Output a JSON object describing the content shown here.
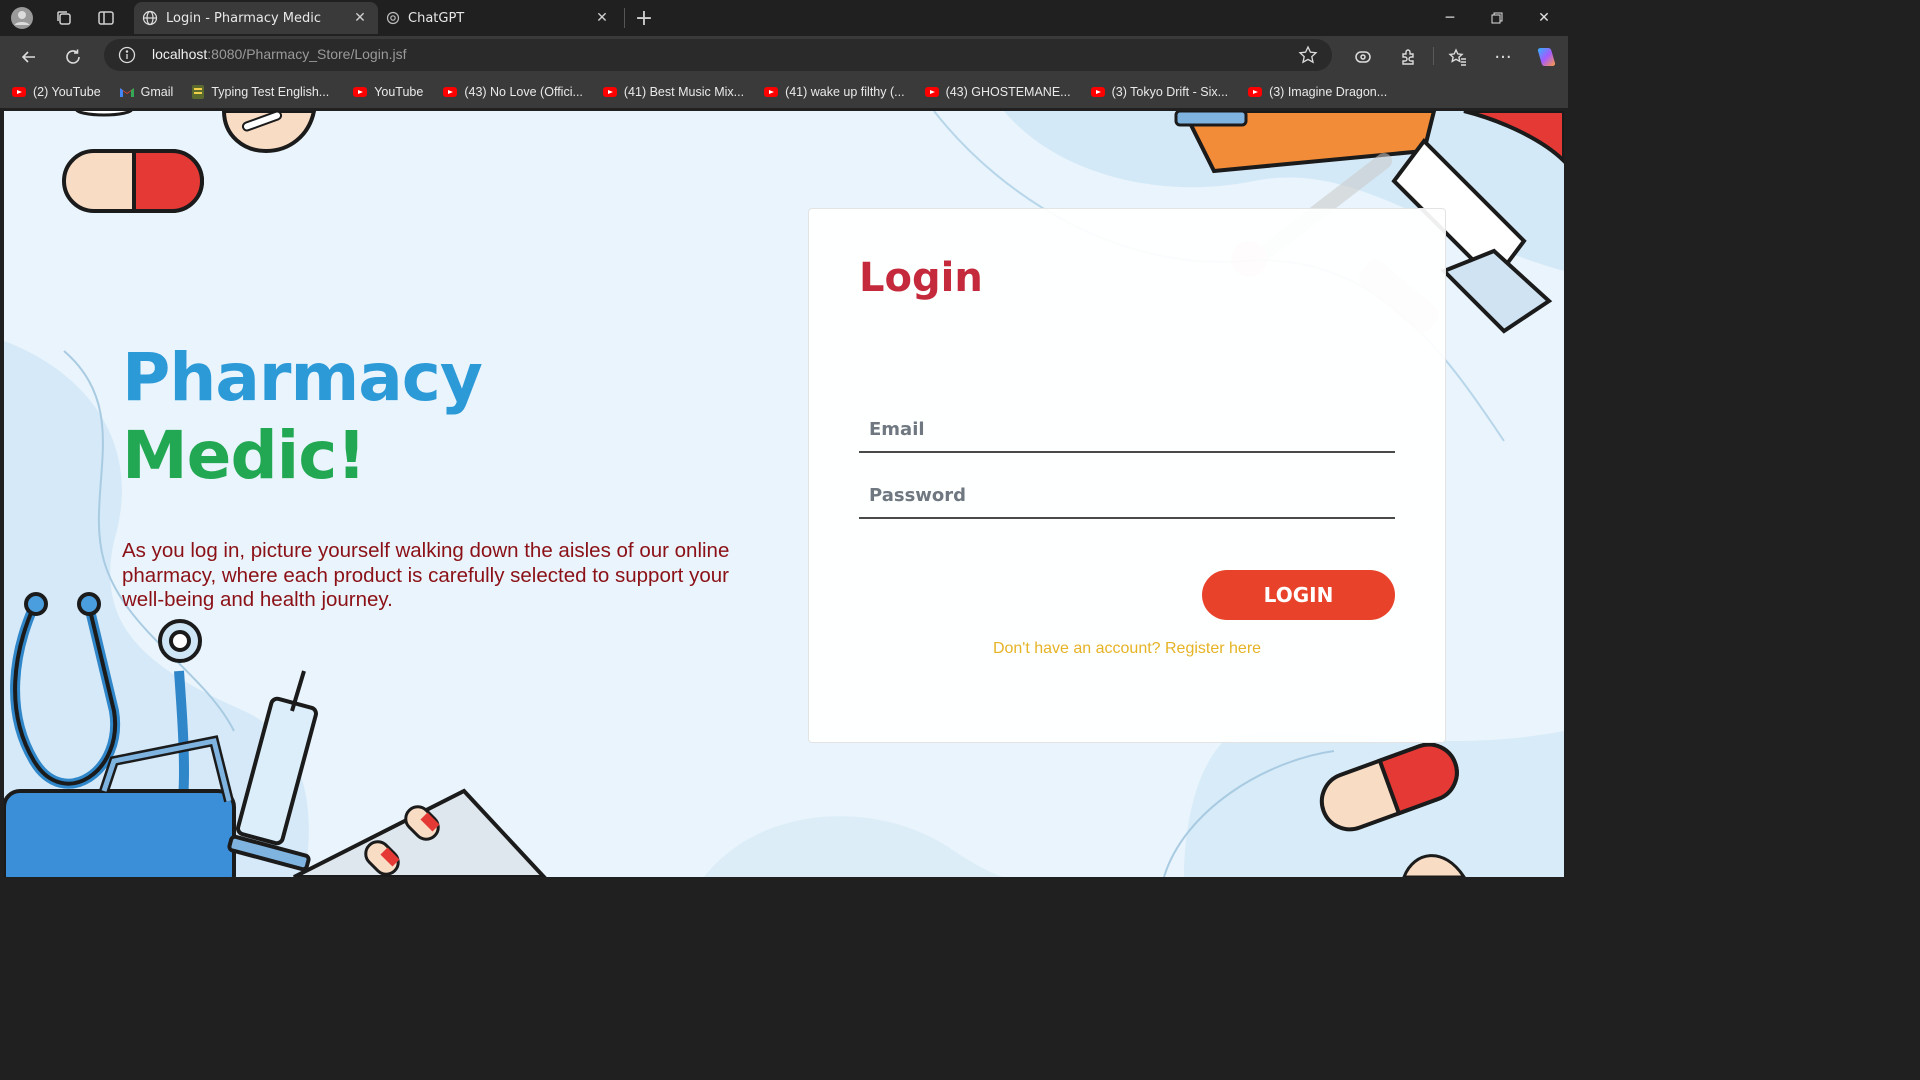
{
  "browser": {
    "tabs": [
      {
        "title": "Login - Pharmacy Medic",
        "icon": "globe-icon",
        "active": true
      },
      {
        "title": "ChatGPT",
        "icon": "chatgpt-icon",
        "active": false
      }
    ],
    "address": {
      "host": "localhost",
      "path": ":8080/Pharmacy_Store/Login.jsf"
    },
    "bookmarks": [
      {
        "label": "(2) YouTube",
        "icon": "youtube-icon"
      },
      {
        "label": "Gmail",
        "icon": "gmail-icon"
      },
      {
        "label": "Typing Test English...",
        "icon": "typing-test-icon"
      },
      {
        "label": "YouTube",
        "icon": "youtube-icon"
      },
      {
        "label": "(43) No Love (Offici...",
        "icon": "youtube-icon"
      },
      {
        "label": "(41) Best Music Mix...",
        "icon": "youtube-icon"
      },
      {
        "label": "(41) wake up filthy (...",
        "icon": "youtube-icon"
      },
      {
        "label": "(43) GHOSTEMANE...",
        "icon": "youtube-icon"
      },
      {
        "label": "(3) Tokyo Drift - Six...",
        "icon": "youtube-icon"
      },
      {
        "label": "(3) Imagine Dragon...",
        "icon": "youtube-icon"
      }
    ]
  },
  "page": {
    "brand_line1": "Pharmacy",
    "brand_line2": "Medic!",
    "tagline": "As you log in, picture yourself walking down the aisles of our online pharmacy, where each product is carefully selected to support your well-being and health journey.",
    "login": {
      "title": "Login",
      "email_placeholder": "Email",
      "password_placeholder": "Password",
      "button_label": "LOGIN",
      "register_link": "Don't have an account? Register here"
    }
  },
  "colors": {
    "brand_blue": "#2d9ad8",
    "brand_green": "#22a852",
    "tagline_red": "#8b1116",
    "login_title": "#c42a3b",
    "login_button": "#e8432a",
    "register_link": "#e6b325"
  }
}
